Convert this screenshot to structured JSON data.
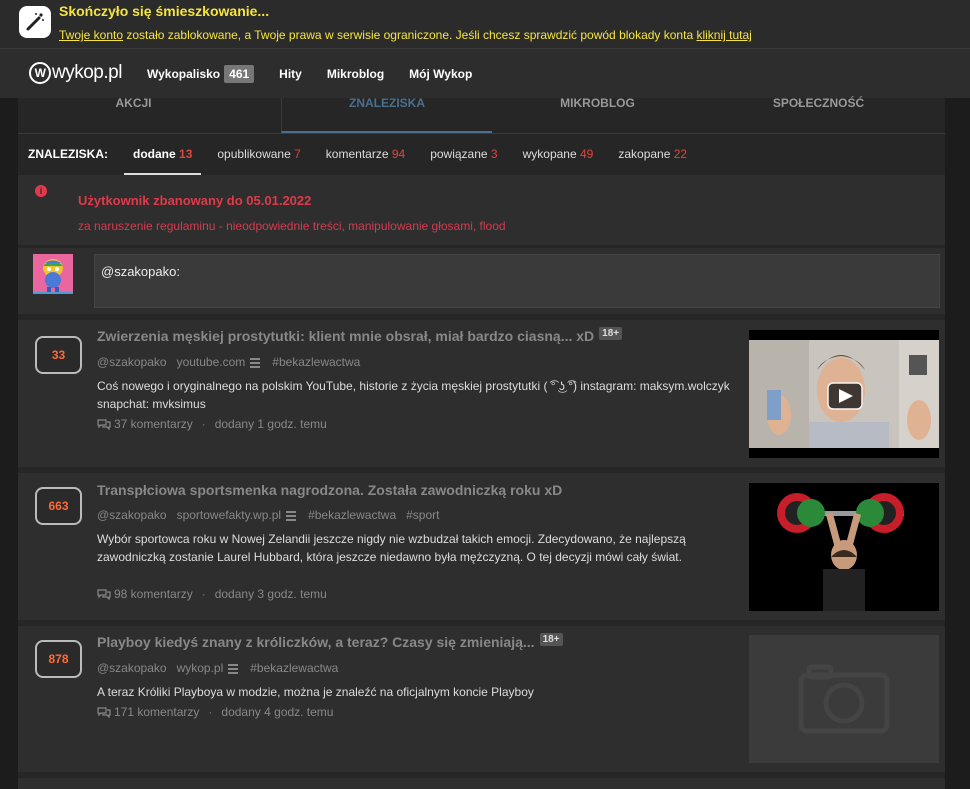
{
  "banner": {
    "title": "Skończyło się śmieszkowanie...",
    "link_account": "Twoje konto",
    "text": " zostało zablokowane, a Twoje prawa w serwisie ograniczone. Jeśli chcesz sprawdzić powód blokady konta ",
    "link_here": "kliknij tutaj"
  },
  "nav": {
    "logo": "wykop.pl",
    "items": [
      {
        "label": "Wykopalisko",
        "badge": "461"
      },
      {
        "label": "Hity"
      },
      {
        "label": "Mikroblog"
      },
      {
        "label": "Mój Wykop"
      }
    ]
  },
  "subtabs": [
    "AKCJI",
    "ZNALEZISKA",
    "MIKROBLOG",
    "SPOŁECZNOŚĆ"
  ],
  "filters": {
    "label": "ZNALEZISKA:",
    "items": [
      {
        "label": "dodane",
        "count": "13"
      },
      {
        "label": "opublikowane",
        "count": "7"
      },
      {
        "label": "komentarze",
        "count": "94"
      },
      {
        "label": "powiązane",
        "count": "3"
      },
      {
        "label": "wykopane",
        "count": "49"
      },
      {
        "label": "zakopane",
        "count": "22"
      }
    ]
  },
  "alert": {
    "icon": "info-icon",
    "title": "Użytkownik zbanowany do 05.01.2022",
    "reason": "za naruszenie regulaminu - nieodpowiednie treści, manipulowanie głosami, flood"
  },
  "comment": {
    "value": "@szakopako:"
  },
  "entries": [
    {
      "votes": "33",
      "title": "Zwierzenia męskiej prostytutki: klient mnie obsrał, miał bardzo ciasną... xD",
      "age": "18+",
      "author": "@szakopako",
      "domain": "youtube.com",
      "tags": [
        "#bekazlewactwa"
      ],
      "description": "Coś nowego i oryginalnego na polskim YouTube, historie z życia męskiej prostytutki ( ͡° ͜ʖ ͡°) instagram: maksym.wolczyk snapchat: mvksimus",
      "comments": "37 komentarzy",
      "added": "dodany 1 godz. temu"
    },
    {
      "votes": "663",
      "title": "Transpłciowa sportsmenka nagrodzona. Została zawodniczką roku xD",
      "age": "",
      "author": "@szakopako",
      "domain": "sportowefakty.wp.pl",
      "tags": [
        "#bekazlewactwa",
        "#sport"
      ],
      "description": "Wybór sportowca roku w Nowej Zelandii jeszcze nigdy nie wzbudzał takich emocji. Zdecydowano, że najlepszą zawodniczką zostanie Laurel Hubbard, która jeszcze niedawno była mężczyzną. O tej decyzji mówi cały świat.",
      "comments": "98 komentarzy",
      "added": "dodany 3 godz. temu"
    },
    {
      "votes": "878",
      "title": "Playboy kiedyś znany z króliczków, a teraz? Czasy się zmieniają...",
      "age": "18+",
      "author": "@szakopako",
      "domain": "wykop.pl",
      "tags": [
        "#bekazlewactwa"
      ],
      "description": "A teraz Króliki Playboya w modzie, można je znaleźć na oficjalnym koncie Playboy",
      "comments": "171 komentarzy",
      "added": "dodany 4 godz. temu"
    }
  ]
}
